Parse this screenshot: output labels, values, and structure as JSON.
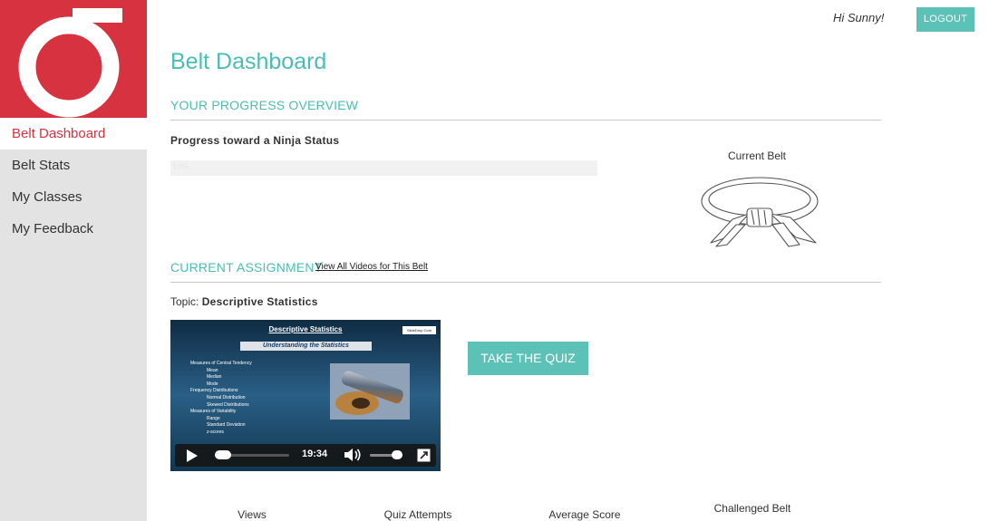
{
  "logo": {
    "glyph": "σ",
    "bg_color": "#d6323f"
  },
  "sidebar": {
    "items": [
      {
        "label": "Belt Dashboard",
        "active": true
      },
      {
        "label": "Belt Stats"
      },
      {
        "label": "My Classes"
      },
      {
        "label": "My Feedback"
      }
    ]
  },
  "header": {
    "greeting": "Hi Sunny!",
    "logout_label": "LOGOUT"
  },
  "page": {
    "title": "Belt Dashboard"
  },
  "progress": {
    "heading": "YOUR PROGRESS OVERVIEW",
    "label": "Progress toward a Ninja Status",
    "value_text": "10%",
    "value": 10
  },
  "current_belt": {
    "label": "Current Belt",
    "icon": "belt-icon"
  },
  "assignment": {
    "heading": "CURRENT ASSIGNMENT",
    "view_all_label": "View All Videos for This Belt",
    "topic_prefix": "Topic:",
    "topic_name": "Descriptive Statistics"
  },
  "video": {
    "slide_title": "Descriptive Statistics",
    "slide_subtitle": "Understanding the Statistics",
    "watermark": "SlideDrop.Com",
    "bullets": [
      {
        "text": "Measures of Central Tendency",
        "sub": [
          "Mean",
          "Median",
          "Mode"
        ]
      },
      {
        "text": "Frequency Distributions",
        "sub": [
          "Normal Distribution",
          "Skewed Distributions"
        ]
      },
      {
        "text": "Measures of Variability",
        "sub": [
          "Range",
          "Standard Deviation",
          "z-scores"
        ]
      }
    ],
    "duration": "19:34"
  },
  "quiz_button": {
    "label": "TAKE THE QUIZ"
  },
  "stats": {
    "views_label": "Views",
    "quiz_attempts_label": "Quiz Attempts",
    "average_score_label": "Average Score",
    "challenged_belt_label": "Challenged Belt"
  },
  "colors": {
    "accent": "#5cc1b6",
    "brand": "#d6323f",
    "sidebar_bg": "#e3e3e3"
  }
}
